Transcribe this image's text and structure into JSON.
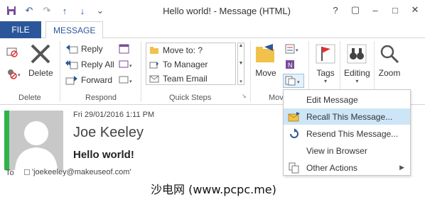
{
  "title_bar": {
    "title": "Hello world! - Message (HTML)",
    "controls": [
      "?",
      "▢",
      "–",
      "□",
      "✕"
    ]
  },
  "tabs": {
    "file": "FILE",
    "message": "MESSAGE"
  },
  "ribbon": {
    "delete_group": {
      "delete_label": "Delete",
      "group_label": "Delete"
    },
    "respond_group": {
      "reply": "Reply",
      "reply_all": "Reply All",
      "forward": "Forward",
      "group_label": "Respond"
    },
    "quick_steps": {
      "items": [
        "Move to: ?",
        "To Manager",
        "Team Email"
      ],
      "group_label": "Quick Steps"
    },
    "move_group": {
      "move_label": "Move",
      "group_label": "Mov"
    },
    "tags_label": "Tags",
    "editing_label": "Editing",
    "zoom_label": "Zoom"
  },
  "message": {
    "date": "Fri 29/01/2016 1:11 PM",
    "sender": "Joe Keeley",
    "subject": "Hello world!",
    "to_label": "To",
    "to_value": "'joekeeley@makeuseof.com'"
  },
  "actions_menu": {
    "items": [
      {
        "label": "Edit Message",
        "icon": "edit-icon"
      },
      {
        "label": "Recall This Message...",
        "icon": "recall-envelope-icon",
        "highlighted": true
      },
      {
        "label": "Resend This Message...",
        "icon": "resend-icon"
      },
      {
        "label": "View in Browser",
        "icon": ""
      },
      {
        "label": "Other Actions",
        "icon": "actions-icon",
        "has_submenu": true
      }
    ]
  },
  "watermark": "沙电网 (www.pcpc.me)",
  "colors": {
    "accent": "#2b579a",
    "highlight": "#cde6f7",
    "presence": "#2fb34a"
  }
}
